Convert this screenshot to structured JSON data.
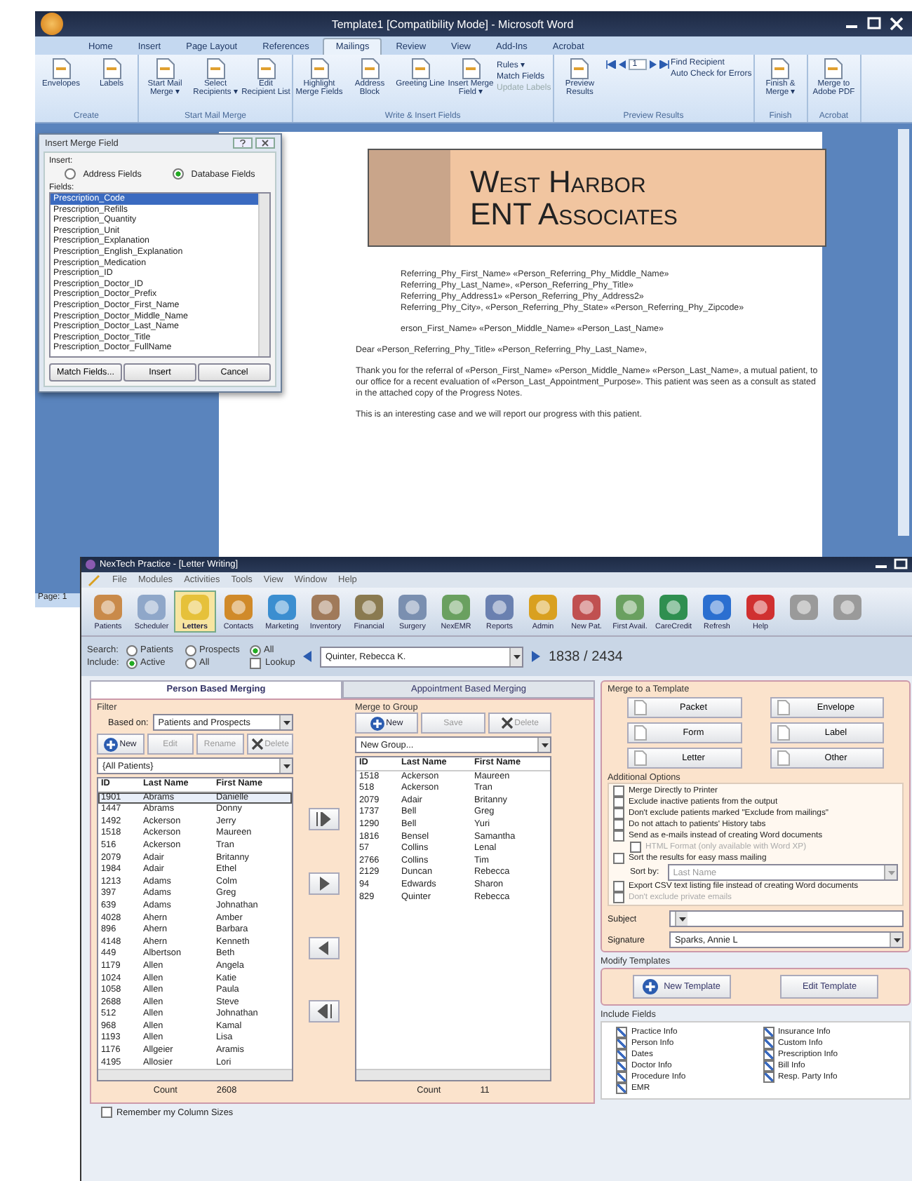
{
  "word": {
    "title": "Template1 [Compatibility Mode] - Microsoft Word",
    "tabs": [
      {
        "label": "Home",
        "selected": false
      },
      {
        "label": "Insert",
        "selected": false
      },
      {
        "label": "Page Layout",
        "selected": false
      },
      {
        "label": "References",
        "selected": false
      },
      {
        "label": "Mailings",
        "selected": true
      },
      {
        "label": "Review",
        "selected": false
      },
      {
        "label": "View",
        "selected": false
      },
      {
        "label": "Add-Ins",
        "selected": false
      },
      {
        "label": "Acrobat",
        "selected": false
      }
    ],
    "ribbon_groups": [
      {
        "label": "Create",
        "buttons": [
          "Envelopes",
          "Labels"
        ]
      },
      {
        "label": "Start Mail Merge",
        "buttons": [
          "Start Mail Merge ▾",
          "Select Recipients ▾",
          "Edit Recipient List"
        ]
      },
      {
        "label": "Write & Insert Fields",
        "buttons": [
          "Highlight Merge Fields",
          "Address Block",
          "Greeting Line",
          "Insert Merge Field ▾"
        ],
        "small": [
          {
            "label": "Rules ▾",
            "disabled": false
          },
          {
            "label": "Match Fields",
            "disabled": false
          },
          {
            "label": "Update Labels",
            "disabled": true
          }
        ]
      },
      {
        "label": "Preview Results",
        "buttons": [
          "Preview Results"
        ],
        "small": [
          {
            "label": "Find Recipient",
            "disabled": false
          },
          {
            "label": "Auto Check for Errors",
            "disabled": false
          }
        ],
        "record": "1"
      },
      {
        "label": "Finish",
        "buttons": [
          "Finish & Merge ▾"
        ]
      },
      {
        "label": "Acrobat",
        "buttons": [
          "Merge to Adobe PDF"
        ]
      }
    ],
    "letterhead": {
      "line1": "West Harbor",
      "line2": "ENT Associates"
    },
    "letter_blocks": [
      [
        {
          "text": "Referring_Phy_First_Name» «Person_Referring_Phy_Middle_Name»",
          "kind": "partial"
        },
        {
          "text": "Referring_Phy_Last_Name», «Person_Referring_Phy_Title»",
          "kind": "partial"
        },
        {
          "text": "Referring_Phy_Address1» «Person_Referring_Phy_Address2»",
          "kind": "partial"
        },
        {
          "text": "Referring_Phy_City», «Person_Referring_Phy_State» «Person_Referring_Phy_Zipcode»",
          "kind": "partial"
        }
      ],
      [
        {
          "text": "erson_First_Name» «Person_Middle_Name» «Person_Last_Name»",
          "kind": "partial"
        }
      ],
      [
        {
          "text": "Dear «Person_Referring_Phy_Title» «Person_Referring_Phy_Last_Name»,",
          "kind": "full"
        }
      ],
      [
        {
          "text": "Thank you for the referral of «Person_First_Name» «Person_Middle_Name» «Person_Last_Name», a mutual patient, to our office for a recent evaluation of «Person_Last_Appointment_Purpose». This patient was seen as a consult as stated in the attached copy of the Progress Notes.",
          "kind": "full"
        }
      ],
      [
        {
          "text": "This is an interesting case and we will report our progress with this patient.",
          "kind": "full"
        }
      ]
    ],
    "status": "Page: 1"
  },
  "merge_dialog": {
    "title": "Insert Merge Field",
    "insert_label": "Insert:",
    "options": [
      {
        "label": "Address Fields",
        "selected": false
      },
      {
        "label": "Database Fields",
        "selected": true
      }
    ],
    "fields_label": "Fields:",
    "fields": [
      {
        "label": "Prescription_Code",
        "selected": true
      },
      {
        "label": "Prescription_Refills",
        "selected": false
      },
      {
        "label": "Prescription_Quantity",
        "selected": false
      },
      {
        "label": "Prescription_Unit",
        "selected": false
      },
      {
        "label": "Prescription_Explanation",
        "selected": false
      },
      {
        "label": "Prescription_English_Explanation",
        "selected": false
      },
      {
        "label": "Prescription_Medication",
        "selected": false
      },
      {
        "label": "Prescription_ID",
        "selected": false
      },
      {
        "label": "Prescription_Doctor_ID",
        "selected": false
      },
      {
        "label": "Prescription_Doctor_Prefix",
        "selected": false
      },
      {
        "label": "Prescription_Doctor_First_Name",
        "selected": false
      },
      {
        "label": "Prescription_Doctor_Middle_Name",
        "selected": false
      },
      {
        "label": "Prescription_Doctor_Last_Name",
        "selected": false
      },
      {
        "label": "Prescription_Doctor_Title",
        "selected": false
      },
      {
        "label": "Prescription_Doctor_FullName",
        "selected": false
      }
    ],
    "buttons": [
      "Match Fields...",
      "Insert",
      "Cancel"
    ]
  },
  "app": {
    "title": "NexTech Practice - [Letter Writing]",
    "menu": [
      "File",
      "Modules",
      "Activities",
      "Tools",
      "View",
      "Window",
      "Help"
    ],
    "toolbar": [
      {
        "label": "Patients",
        "selected": false,
        "disabled": false
      },
      {
        "label": "Scheduler",
        "selected": false,
        "disabled": false
      },
      {
        "label": "Letters",
        "selected": true,
        "disabled": false
      },
      {
        "label": "Contacts",
        "selected": false,
        "disabled": false
      },
      {
        "label": "Marketing",
        "selected": false,
        "disabled": false
      },
      {
        "label": "Inventory",
        "selected": false,
        "disabled": false
      },
      {
        "label": "Financial",
        "selected": false,
        "disabled": false
      },
      {
        "label": "Surgery",
        "selected": false,
        "disabled": false
      },
      {
        "label": "NexEMR",
        "selected": false,
        "disabled": false
      },
      {
        "label": "Reports",
        "selected": false,
        "disabled": false
      },
      {
        "label": "Admin",
        "selected": false,
        "disabled": false
      },
      {
        "label": "New Pat.",
        "selected": false,
        "disabled": false
      },
      {
        "label": "First Avail.",
        "selected": false,
        "disabled": false
      },
      {
        "label": "CareCredit",
        "selected": false,
        "disabled": false
      },
      {
        "label": "Refresh",
        "selected": false,
        "disabled": false
      },
      {
        "label": "Help",
        "selected": false,
        "disabled": false
      },
      {
        "selected": false,
        "disabled": true
      },
      {
        "selected": false,
        "disabled": true
      }
    ],
    "search": {
      "label": "Search:",
      "options": [
        {
          "label": "Patients",
          "kind": "radio",
          "selected": false
        },
        {
          "label": "Prospects",
          "kind": "radio",
          "selected": false
        },
        {
          "label": "All",
          "kind": "radio",
          "selected": true
        }
      ]
    },
    "include": {
      "label": "Include:",
      "options": [
        {
          "label": "Active",
          "kind": "radio",
          "selected": true
        },
        {
          "label": "All",
          "kind": "radio",
          "selected": false
        },
        {
          "label": "Lookup",
          "kind": "checkbox",
          "selected": false
        }
      ]
    },
    "patient": "Quinter, Rebecca K.",
    "record": "1838 / 2434",
    "tabs": [
      {
        "label": "Person Based Merging",
        "selected": true
      },
      {
        "label": "Appointment Based Merging",
        "selected": false
      }
    ],
    "filter": {
      "label": "Filter",
      "based_on_label": "Based on:",
      "based_on": "Patients and Prospects",
      "buttons": [
        {
          "label": "New",
          "disabled": false
        },
        {
          "label": "Edit",
          "disabled": true
        },
        {
          "label": "Rename",
          "disabled": true
        },
        {
          "label": "Delete",
          "disabled": true
        }
      ],
      "group": "{All Patients}",
      "columns": [
        "ID",
        "Last Name",
        "First Name"
      ],
      "rows": [
        {
          "cells": [
            "1901",
            "Abrams",
            "Danielle"
          ],
          "selected": true
        },
        {
          "cells": [
            "1447",
            "Abrams",
            "Donny"
          ],
          "selected": false
        },
        {
          "cells": [
            "1492",
            "Ackerson",
            "Jerry"
          ],
          "selected": false
        },
        {
          "cells": [
            "1518",
            "Ackerson",
            "Maureen"
          ],
          "selected": false
        },
        {
          "cells": [
            "516",
            "Ackerson",
            "Tran"
          ],
          "selected": false
        },
        {
          "cells": [
            "2079",
            "Adair",
            "Britanny"
          ],
          "selected": false
        },
        {
          "cells": [
            "1984",
            "Adair",
            "Ethel"
          ],
          "selected": false
        },
        {
          "cells": [
            "1213",
            "Adams",
            "Colm"
          ],
          "selected": false
        },
        {
          "cells": [
            "397",
            "Adams",
            "Greg"
          ],
          "selected": false
        },
        {
          "cells": [
            "639",
            "Adams",
            "Johnathan"
          ],
          "selected": false
        },
        {
          "cells": [
            "4028",
            "Ahern",
            "Amber"
          ],
          "selected": false
        },
        {
          "cells": [
            "896",
            "Ahern",
            "Barbara"
          ],
          "selected": false
        },
        {
          "cells": [
            "4148",
            "Ahern",
            "Kenneth"
          ],
          "selected": false
        },
        {
          "cells": [
            "449",
            "Albertson",
            "Beth"
          ],
          "selected": false
        },
        {
          "cells": [
            "1179",
            "Allen",
            "Angela"
          ],
          "selected": false
        },
        {
          "cells": [
            "1024",
            "Allen",
            "Katie"
          ],
          "selected": false
        },
        {
          "cells": [
            "1058",
            "Allen",
            "Paula"
          ],
          "selected": false
        },
        {
          "cells": [
            "2688",
            "Allen",
            "Steve"
          ],
          "selected": false
        },
        {
          "cells": [
            "512",
            "Allen",
            "Johnathan"
          ],
          "selected": false
        },
        {
          "cells": [
            "968",
            "Allen",
            "Kamal"
          ],
          "selected": false
        },
        {
          "cells": [
            "1193",
            "Allen",
            "Lisa"
          ],
          "selected": false
        },
        {
          "cells": [
            "1176",
            "Allgeier",
            "Aramis"
          ],
          "selected": false
        },
        {
          "cells": [
            "4195",
            "Allosier",
            "Lori"
          ],
          "selected": false
        }
      ],
      "count_label": "Count",
      "count": "2608"
    },
    "merge_group": {
      "label": "Merge to Group",
      "buttons": [
        {
          "label": "New",
          "disabled": false
        },
        {
          "label": "Save",
          "disabled": true
        },
        {
          "label": "Delete",
          "disabled": true
        }
      ],
      "group": "New Group...",
      "columns": [
        "ID",
        "Last Name",
        "First Name"
      ],
      "rows": [
        [
          "1518",
          "Ackerson",
          "Maureen"
        ],
        [
          "518",
          "Ackerson",
          "Tran"
        ],
        [
          "2079",
          "Adair",
          "Britanny"
        ],
        [
          "1737",
          "Bell",
          "Greg"
        ],
        [
          "1290",
          "Bell",
          "Yuri"
        ],
        [
          "1816",
          "Bensel",
          "Samantha"
        ],
        [
          "57",
          "Collins",
          "Lenal"
        ],
        [
          "2766",
          "Collins",
          "Tim"
        ],
        [
          "2129",
          "Duncan",
          "Rebecca"
        ],
        [
          "94",
          "Edwards",
          "Sharon"
        ],
        [
          "829",
          "Quinter",
          "Rebecca"
        ]
      ],
      "count_label": "Count",
      "count": "11"
    },
    "remember_columns": {
      "label": "Remember my Column Sizes",
      "checked": false
    },
    "template": {
      "label": "Merge to a Template",
      "buttons": [
        "Packet",
        "Envelope",
        "Form",
        "Label",
        "Letter",
        "Other"
      ]
    },
    "options": {
      "label": "Additional Options",
      "items": [
        {
          "label": "Merge Directly to Printer",
          "checked": false,
          "disabled": false,
          "indent": false
        },
        {
          "label": "Exclude inactive patients from the output",
          "checked": false,
          "disabled": false,
          "indent": false
        },
        {
          "label": "Don't exclude patients marked \"Exclude from mailings\"",
          "checked": false,
          "disabled": false,
          "indent": false
        },
        {
          "label": "Do not attach to patients' History tabs",
          "checked": false,
          "disabled": false,
          "indent": false
        },
        {
          "label": "Send as e-mails instead of creating Word documents",
          "checked": false,
          "disabled": false,
          "indent": false
        },
        {
          "label": "HTML Format (only available with Word XP)",
          "checked": false,
          "disabled": true,
          "indent": true
        },
        {
          "label": "Sort the results for easy mass mailing",
          "checked": false,
          "disabled": false,
          "indent": false
        }
      ],
      "sort_label": "Sort by:",
      "sort_value": "Last Name",
      "more_items": [
        {
          "label": "Export CSV text listing file instead of creating Word documents",
          "checked": false,
          "disabled": false
        },
        {
          "label": "Don't exclude private emails",
          "checked": false,
          "disabled": true
        }
      ],
      "subject_label": "Subject",
      "signature_label": "Signature",
      "signature": "Sparks, Annie L"
    },
    "modify": {
      "label": "Modify Templates",
      "buttons": [
        "New Template",
        "Edit Template"
      ]
    },
    "include_fields": {
      "label": "Include Fields",
      "columns": [
        [
          {
            "label": "Practice Info",
            "checked": true
          },
          {
            "label": "Person Info",
            "checked": true
          },
          {
            "label": "Dates",
            "checked": true
          },
          {
            "label": "Doctor Info",
            "checked": true
          },
          {
            "label": "Procedure Info",
            "checked": true
          },
          {
            "label": "EMR",
            "checked": true
          }
        ],
        [
          {
            "label": "Insurance Info",
            "checked": true
          },
          {
            "label": "Custom Info",
            "checked": true
          },
          {
            "label": "Prescription Info",
            "checked": true
          },
          {
            "label": "Bill Info",
            "checked": true
          },
          {
            "label": "Resp. Party Info",
            "checked": true
          }
        ]
      ]
    }
  }
}
